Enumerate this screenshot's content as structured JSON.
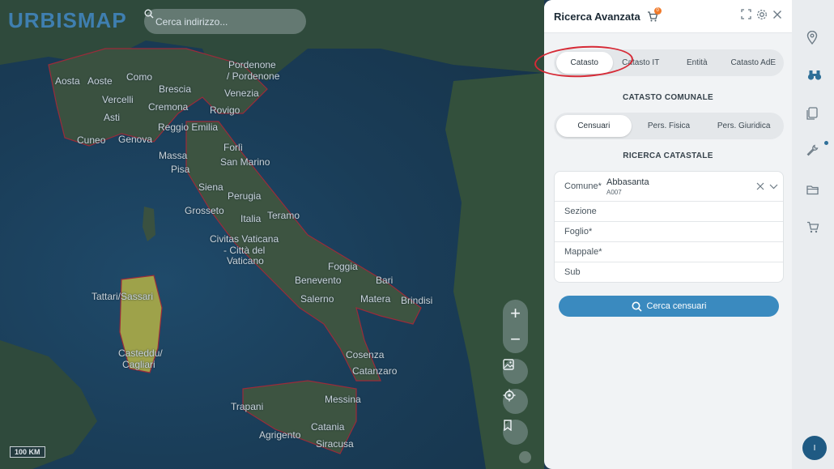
{
  "map": {
    "logo": "URBISMAP",
    "search_placeholder": "Cerca indirizzo...",
    "scale_label": "100 KM",
    "cities": [
      "Aosta",
      "Aoste",
      "Como",
      "Pordenone",
      "/ Pordenone",
      "Brescia",
      "Venezia",
      "Vercelli",
      "Cremona",
      "Rovigo",
      "Asti",
      "Reggio Emilia",
      "Cuneo",
      "Genova",
      "Forlì",
      "Massa",
      "San Marino",
      "Pisa",
      "Siena",
      "Perugia",
      "Grosseto",
      "Italia",
      "Teramo",
      "Civitas Vaticana",
      "- Città del",
      "Vaticano",
      "Foggia",
      "Tattari/Sassari",
      "Benevento",
      "Bari",
      "Salerno",
      "Matera",
      "Brindisi",
      "Casteddu/",
      "Cagliari",
      "Cosenza",
      "Catanzaro",
      "Messina",
      "Trapani",
      "Agrigento",
      "Catania",
      "Siracusa"
    ]
  },
  "panel": {
    "title": "Ricerca Avanzata",
    "cart_badge": "0",
    "tabs": [
      {
        "label": "Catasto",
        "active": true
      },
      {
        "label": "Catasto IT",
        "active": false
      },
      {
        "label": "Entità",
        "active": false
      },
      {
        "label": "Catasto AdE",
        "active": false
      }
    ],
    "section_catasto": "CATASTO COMUNALE",
    "subtabs": [
      {
        "label": "Censuari",
        "active": true
      },
      {
        "label": "Pers. Fisica",
        "active": false
      },
      {
        "label": "Pers. Giuridica",
        "active": false
      }
    ],
    "section_ricerca": "RICERCA CATASTALE",
    "form": {
      "comune_label": "Comune*",
      "comune_value": "Abbasanta",
      "comune_code": "A007",
      "sezione_placeholder": "Sezione",
      "foglio_placeholder": "Foglio*",
      "mappale_placeholder": "Mappale*",
      "sub_placeholder": "Sub"
    },
    "search_button": "Cerca censuari"
  },
  "rail": {
    "avatar_initial": "I"
  },
  "colors": {
    "accent": "#3a8abf",
    "annotation": "#d62a36",
    "badge": "#f07a2b"
  }
}
